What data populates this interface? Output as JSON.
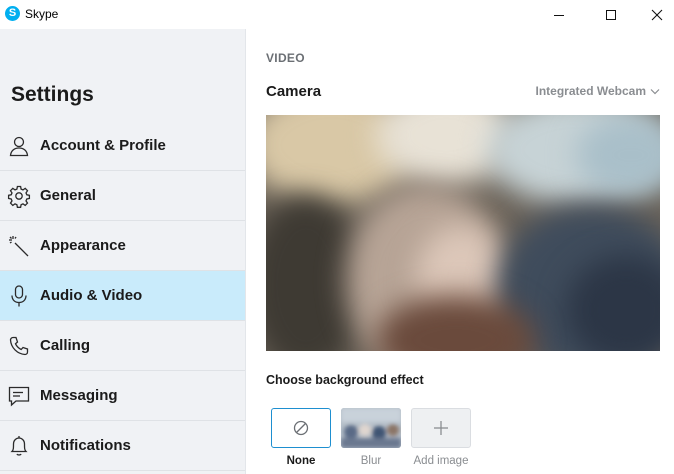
{
  "window": {
    "app_icon_letter": "S",
    "title": "Skype"
  },
  "sidebar": {
    "heading": "Settings",
    "items": [
      {
        "label": "Account & Profile",
        "icon": "person-icon",
        "active": false
      },
      {
        "label": "General",
        "icon": "gear-icon",
        "active": false
      },
      {
        "label": "Appearance",
        "icon": "magic-wand-icon",
        "active": false
      },
      {
        "label": "Audio & Video",
        "icon": "microphone-icon",
        "active": true
      },
      {
        "label": "Calling",
        "icon": "phone-icon",
        "active": false
      },
      {
        "label": "Messaging",
        "icon": "message-icon",
        "active": false
      },
      {
        "label": "Notifications",
        "icon": "bell-icon",
        "active": false
      }
    ]
  },
  "main": {
    "section": "VIDEO",
    "camera_label": "Camera",
    "camera_device": "Integrated Webcam",
    "effects_label": "Choose background effect",
    "effects": [
      {
        "name": "None",
        "selected": true
      },
      {
        "name": "Blur",
        "selected": false
      },
      {
        "name": "Add image",
        "selected": false
      }
    ]
  },
  "colors": {
    "accent": "#00aff0",
    "active_nav": "#c9ebfb",
    "selected_border": "#1e8fd0",
    "sidebar_bg": "#f0f2f5"
  }
}
